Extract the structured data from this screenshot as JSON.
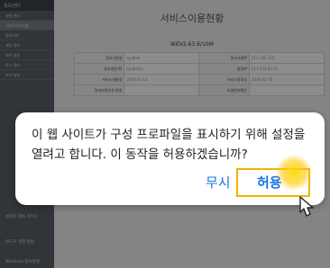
{
  "sidebar": {
    "header": "정보센터",
    "items": [
      {
        "label": "설정 관리",
        "active": false
      },
      {
        "label": "서비스이용현황",
        "active": true
      },
      {
        "label": "접속이력",
        "active": false
      },
      {
        "label": "계정 관리",
        "active": false
      },
      {
        "label": "예약 설정",
        "active": false
      },
      {
        "label": "로그 관리",
        "active": false
      },
      {
        "label": "보안 설정",
        "active": false
      }
    ],
    "lower_items": [
      "설치된 접속 가이드",
      "윈도우 설정 방법",
      "Windows 접속방법"
    ]
  },
  "main": {
    "title": "서비스이용현황",
    "version": "IKEV2.63.6/10M",
    "rows": [
      [
        "접속사용명",
        "hydbe4",
        "접속사용IP",
        "211.182.223"
      ],
      [
        "접속계정 ID",
        "hydbdykr",
        "할당IP",
        "211.233.63.24"
      ],
      [
        "서비스개통일",
        "2018-01-16",
        "서비스종료일",
        "2018-02-16"
      ],
      [
        "접속비밀번호 변경",
        "",
        "비밀번호확인",
        ""
      ]
    ]
  },
  "dialog": {
    "message": "이 웹 사이트가 구성 프로파일을 표시하기 위해 설정을 열려고 합니다. 이 동작을 허용하겠습니까?",
    "ignore_label": "무시",
    "allow_label": "허용",
    "accent_color": "#1a73e8",
    "highlight_color": "#f0b400"
  },
  "cursor": {
    "icon": "hand-pointer-icon"
  }
}
